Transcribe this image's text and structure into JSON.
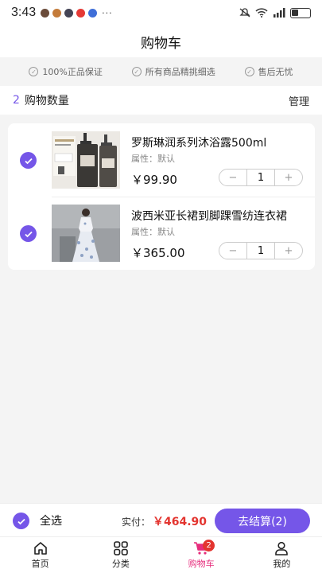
{
  "status_bar": {
    "time": "3:43",
    "more": "···"
  },
  "header": {
    "title": "购物车"
  },
  "guarantees": [
    "100%正品保证",
    "所有商品精挑细选",
    "售后无忧"
  ],
  "cart_summary": {
    "count": "2",
    "count_label": "购物数量",
    "manage_label": "管理"
  },
  "items": [
    {
      "title": "罗斯琳润系列沐浴露500ml",
      "attr_label": "属性：",
      "attr_value": "默认",
      "price": "￥99.90",
      "quantity": "1",
      "minus": "−",
      "plus": "+",
      "checked": true
    },
    {
      "title": "波西米亚长裙到脚踝雪纺连衣裙",
      "attr_label": "属性：",
      "attr_value": "默认",
      "price": "￥365.00",
      "quantity": "1",
      "minus": "−",
      "plus": "+",
      "checked": true
    }
  ],
  "checkout": {
    "select_all": "全选",
    "paid_label": "实付：",
    "total": "￥464.90",
    "button": "去结算(2)"
  },
  "tabbar": [
    {
      "label": "首页",
      "icon": "home-icon"
    },
    {
      "label": "分类",
      "icon": "category-icon"
    },
    {
      "label": "购物车",
      "icon": "cart-icon",
      "badge": "2",
      "active": true
    },
    {
      "label": "我的",
      "icon": "user-icon"
    }
  ],
  "colors": {
    "accent": "#7556e8",
    "price": "#e3342f",
    "active_tab": "#e62d7c"
  }
}
